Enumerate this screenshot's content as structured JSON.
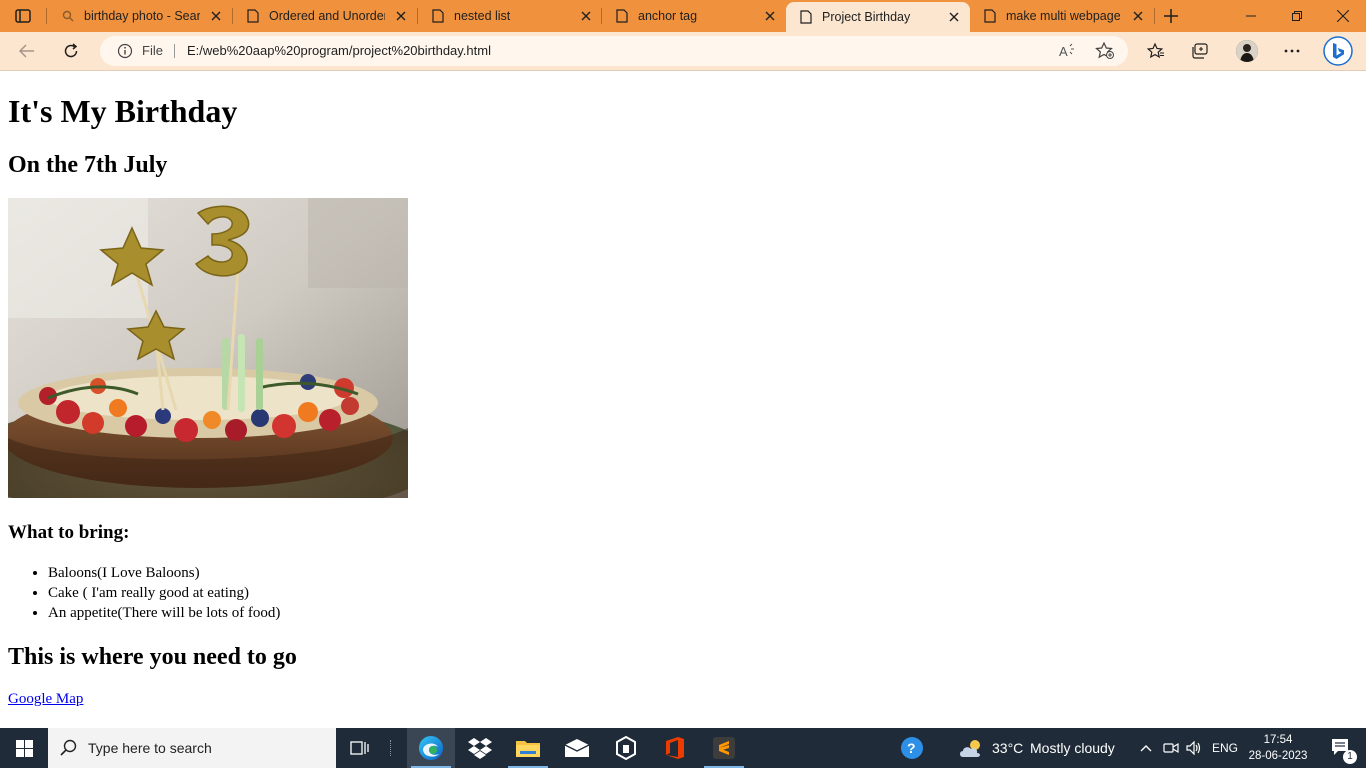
{
  "browser": {
    "tabs": [
      {
        "title": "birthday photo - Search",
        "icon": "search-icon",
        "active": false
      },
      {
        "title": "Ordered and Unordered",
        "icon": "page-icon",
        "active": false
      },
      {
        "title": "nested list",
        "icon": "page-icon",
        "active": false
      },
      {
        "title": "anchor tag",
        "icon": "page-icon",
        "active": false
      },
      {
        "title": "Project Birthday",
        "icon": "page-icon",
        "active": true
      },
      {
        "title": "make multi webpage",
        "icon": "page-icon",
        "active": false
      }
    ],
    "address": {
      "scheme_label": "File",
      "url": "E:/web%20aap%20program/project%20birthday.html"
    },
    "accent_color": "#f0923d",
    "toolbar_color": "#fde6d0"
  },
  "page": {
    "heading": "It's My Birthday",
    "date": "On the 7th July",
    "image_subject": "birthday-cake-photo",
    "bring_heading": "What to bring:",
    "bring_items": [
      "Baloons(I Love Baloons)",
      "Cake ( I'am really good at eating)",
      "An appetite(There will be lots of food)"
    ],
    "where_heading": "This is where you need to go",
    "map_link": "Google Map"
  },
  "taskbar": {
    "search_placeholder": "Type here to search",
    "weather": {
      "temp": "33°C",
      "condition": "Mostly cloudy"
    },
    "language": "ENG",
    "time": "17:54",
    "date": "28-06-2023",
    "notification_count": "1"
  }
}
